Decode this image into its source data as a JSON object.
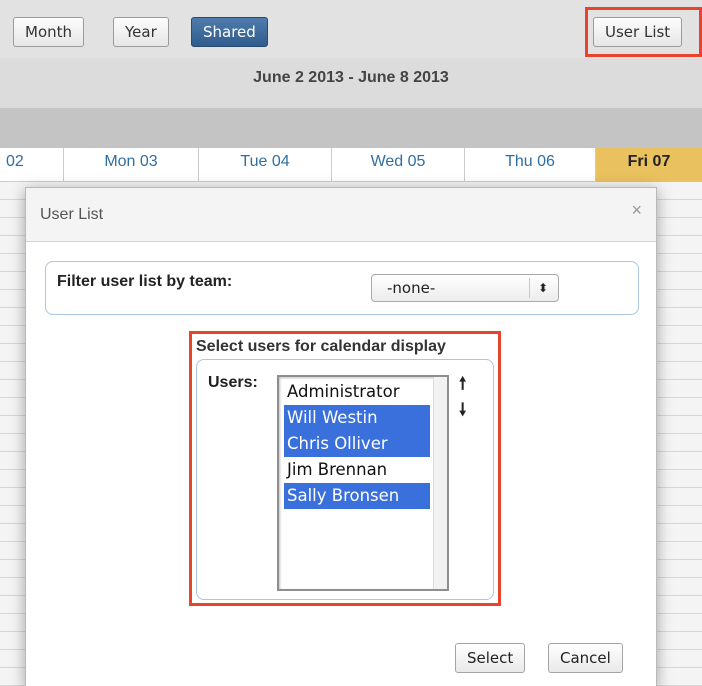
{
  "toolbar": {
    "month_label": "Month",
    "year_label": "Year",
    "shared_label": "Shared",
    "user_list_label": "User List"
  },
  "date_range": "June 2 2013 - June 8 2013",
  "days": [
    "02",
    "Mon 03",
    "Tue 04",
    "Wed 05",
    "Thu 06",
    "Fri 07"
  ],
  "modal": {
    "title": "User List",
    "close_glyph": "×",
    "filter_label": "Filter user list by team:",
    "team_selected": "-none-",
    "users_section_title": "Select users for calendar display",
    "users_label": "Users:",
    "users": [
      {
        "name": "Administrator",
        "selected": false
      },
      {
        "name": "Will Westin",
        "selected": true
      },
      {
        "name": "Chris Olliver",
        "selected": true
      },
      {
        "name": "Jim Brennan",
        "selected": false
      },
      {
        "name": "Sally Bronsen",
        "selected": true
      }
    ],
    "select_label": "Select",
    "cancel_label": "Cancel"
  },
  "colors": {
    "highlight": "#e8432c",
    "selection": "#3a70db",
    "today": "#e9c15e",
    "active_button": "#3a6899"
  }
}
